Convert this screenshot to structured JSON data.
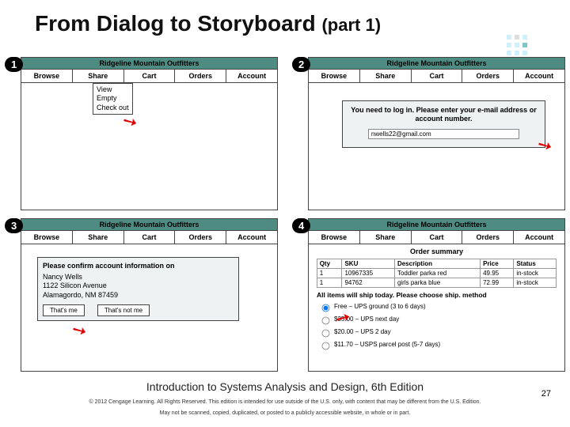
{
  "title_main": "From Dialog to Storyboard",
  "title_part": "(part 1)",
  "brand": "Ridgeline Mountain Outfitters",
  "nav": [
    "Browse",
    "Share",
    "Cart",
    "Orders",
    "Account"
  ],
  "panels": {
    "p1": {
      "badge": "1",
      "dropdown": [
        "View",
        "Empty",
        "Check out"
      ]
    },
    "p2": {
      "badge": "2",
      "prompt": "You need to log in. Please enter your e-mail address or account number.",
      "email_value": "nwells22@gmail.com"
    },
    "p3": {
      "badge": "3",
      "hdr": "Please confirm account information on",
      "name": "Nancy Wells",
      "street": "1122 Silicon Avenue",
      "city": "Alamagordo, NM 87459",
      "btn_yes": "That's me",
      "btn_no": "That's not me"
    },
    "p4": {
      "badge": "4",
      "summary_title": "Order summary",
      "cols": [
        "Qty",
        "SKU",
        "Description",
        "Price",
        "Status"
      ],
      "rows": [
        [
          "1",
          "10967335",
          "Toddler parka red",
          "49.95",
          "in-stock"
        ],
        [
          "1",
          "94762",
          "girls parka blue",
          "72.99",
          "in-stock"
        ]
      ],
      "ship_msg": "All items will ship today. Please choose ship. method",
      "ship_opts": [
        "Free – UPS ground (3 to 6 days)",
        "$35.00 – UPS next day",
        "$20.00 – UPS 2 day",
        "$11.70 – USPS parcel post (5-7 days)"
      ]
    }
  },
  "footer": {
    "book": "Introduction to Systems Analysis and Design, 6th Edition",
    "page": "27",
    "copy1": "© 2012 Cengage Learning. All Rights Reserved. This edition is intended for use outside of the U.S. only, with content that may be different from the U.S. Edition.",
    "copy2": "May not be scanned, copied, duplicated, or posted to a publicly accessible website, in whole or in part."
  }
}
